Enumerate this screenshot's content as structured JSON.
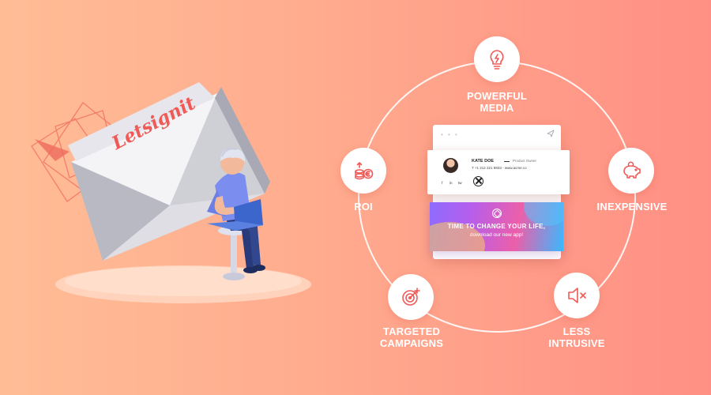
{
  "illustration": {
    "envelope_logo": "Letsignit"
  },
  "benefits": [
    {
      "id": "powerful-media",
      "icon": "lightbulb-icon",
      "lines": [
        "Powerful",
        "Media"
      ]
    },
    {
      "id": "inexpensive",
      "icon": "piggy-bank-icon",
      "lines": [
        "Inexpensive"
      ]
    },
    {
      "id": "less-intrusive",
      "icon": "muted-speaker-icon",
      "lines": [
        "Less",
        "Intrusive"
      ]
    },
    {
      "id": "targeted-campaigns",
      "icon": "target-dart-icon",
      "lines": [
        "Targeted",
        "Campaigns"
      ]
    },
    {
      "id": "roi",
      "icon": "coins-euro-icon",
      "lines": [
        "ROI"
      ]
    }
  ],
  "signature": {
    "toolbar_dots": "• • •",
    "name": "KATE DOE",
    "role": "Product Owner",
    "contact": "T +1 212 221 8833 - www.acme.co",
    "social": [
      "f",
      "in",
      "tw"
    ]
  },
  "banner": {
    "title": "TIME TO CHANGE YOUR LIFE,",
    "subtitle": "download our new app!"
  },
  "colors": {
    "accent": "#ef5a57",
    "background_left": "#ffbd96",
    "background_right": "#ff8f84",
    "ring": "#ffffff"
  }
}
